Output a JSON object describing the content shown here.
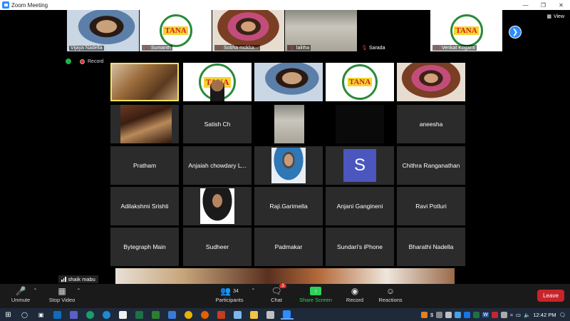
{
  "window": {
    "title": "Zoom Meeting"
  },
  "view_label": "View",
  "top_strip": [
    {
      "name": "Vijaya Nadella",
      "muted": false,
      "kind": "v-woman"
    },
    {
      "name": "Sumanth",
      "muted": true,
      "kind": "v-tana"
    },
    {
      "name": "Sobha mokka...",
      "muted": true,
      "kind": "v-veena"
    },
    {
      "name": "lalitha",
      "muted": true,
      "kind": "v-wall"
    },
    {
      "name": "Sarada",
      "muted": true,
      "kind": "blank"
    },
    {
      "name": "Venkat Koganti",
      "muted": true,
      "kind": "v-tana"
    }
  ],
  "recording_label": "Recording...",
  "grid": [
    {
      "name": "",
      "kind": "v-music1",
      "active": true
    },
    {
      "name": "",
      "kind": "v-tana-man"
    },
    {
      "name": "",
      "kind": "v-woman"
    },
    {
      "name": "",
      "kind": "v-tana"
    },
    {
      "name": "",
      "kind": "v-veena"
    },
    {
      "name": "",
      "kind": "v-instr"
    },
    {
      "name": "Satish Ch",
      "kind": "text"
    },
    {
      "name": "",
      "kind": "v-wall-sm"
    },
    {
      "name": "",
      "kind": "black"
    },
    {
      "name": "aneesha",
      "kind": "text"
    },
    {
      "name": "Pratham",
      "kind": "text"
    },
    {
      "name": "Anjaiah chowdary L...",
      "kind": "text"
    },
    {
      "name": "",
      "kind": "v-man1"
    },
    {
      "name": "",
      "kind": "avatar-s"
    },
    {
      "name": "Chithra Ranganathan",
      "kind": "text"
    },
    {
      "name": "Adilakshmi Srishti",
      "kind": "text"
    },
    {
      "name": "",
      "kind": "v-man2"
    },
    {
      "name": "Raji.Garimella",
      "kind": "text"
    },
    {
      "name": "Anjani Gangineni",
      "kind": "text"
    },
    {
      "name": "Ravi Potluri",
      "kind": "text"
    },
    {
      "name": "Bytegraph Main",
      "kind": "text"
    },
    {
      "name": "Sudheer",
      "kind": "text"
    },
    {
      "name": "Padmakar",
      "kind": "text"
    },
    {
      "name": "Sundari's iPhone",
      "kind": "text"
    },
    {
      "name": "Bharathi Nadella",
      "kind": "text"
    }
  ],
  "avatar_letter": "S",
  "tana_logo_text": "TANA",
  "active_speaker": "shaik mabu",
  "toolbar": {
    "unmute": "Unmute",
    "stop_video": "Stop Video",
    "participants": "Participants",
    "participants_count": "34",
    "chat": "Chat",
    "chat_badge": "3",
    "share_screen": "Share Screen",
    "record": "Record",
    "reactions": "Reactions",
    "leave": "Leave"
  },
  "taskbar": {
    "clock": "12:42 PM"
  },
  "colors": {
    "zoom_blue": "#2d8cff",
    "leave_red": "#c8242b",
    "share_green": "#2fd15a",
    "active_border": "#f2e35c"
  }
}
